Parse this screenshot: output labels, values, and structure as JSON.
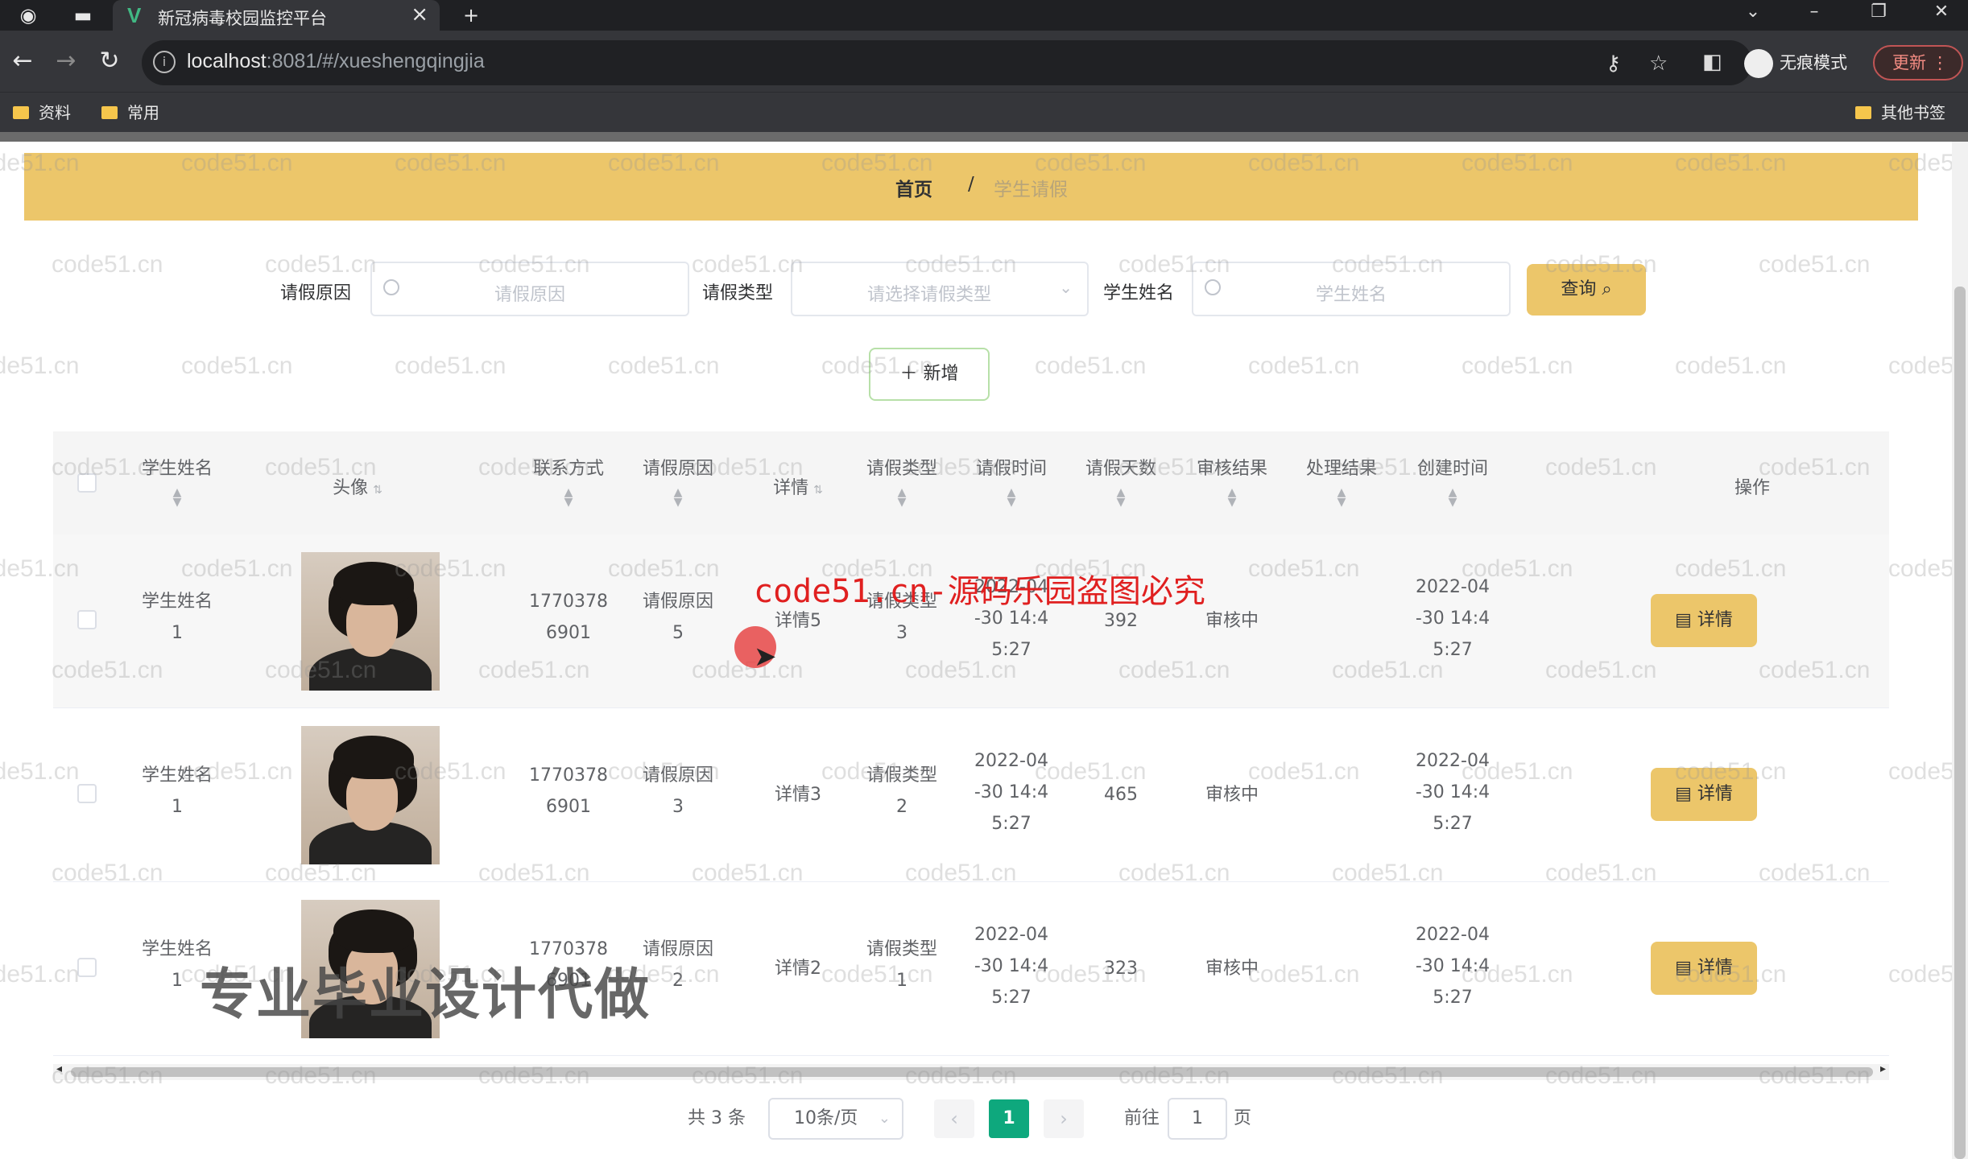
{
  "browser": {
    "tab_title": "新冠病毒校园监控平台",
    "url_host": "localhost",
    "url_rest": ":8081/#/xueshengqingjia",
    "incognito_label": "无痕模式",
    "update_label": "更新",
    "bookmarks": [
      "资料",
      "常用"
    ],
    "other_bookmarks": "其他书签"
  },
  "breadcrumb": {
    "home": "首页",
    "separator": "/",
    "current": "学生请假"
  },
  "search": {
    "fields": [
      {
        "label": "请假原因",
        "placeholder": "请假原因"
      },
      {
        "label": "请假类型",
        "placeholder": "请选择请假类型"
      },
      {
        "label": "学生姓名",
        "placeholder": "学生姓名"
      }
    ],
    "query_label": "查询",
    "add_label": "＋ 新增"
  },
  "table": {
    "columns": [
      "学生姓名",
      "头像",
      "联系方式",
      "请假原因",
      "详情",
      "请假类型",
      "请假时间",
      "请假天数",
      "审核结果",
      "处理结果",
      "创建时间",
      "操作"
    ],
    "rows": [
      {
        "name": "学生姓名\n1",
        "phone": "1770378\n6901",
        "reason": "请假原因\n5",
        "detail": "详情5",
        "type": "请假类型\n3",
        "time": "2022-04\n-30 14:4\n5:27",
        "days": "392",
        "audit": "审核中",
        "result": "",
        "created": "2022-04\n-30 14:4\n5:27"
      },
      {
        "name": "学生姓名\n1",
        "phone": "1770378\n6901",
        "reason": "请假原因\n3",
        "detail": "详情3",
        "type": "请假类型\n2",
        "time": "2022-04\n-30 14:4\n5:27",
        "days": "465",
        "audit": "审核中",
        "result": "",
        "created": "2022-04\n-30 14:4\n5:27"
      },
      {
        "name": "学生姓名\n1",
        "phone": "1770378\n6901",
        "reason": "请假原因\n2",
        "detail": "详情2",
        "type": "请假类型\n1",
        "time": "2022-04\n-30 14:4\n5:27",
        "days": "323",
        "audit": "审核中",
        "result": "",
        "created": "2022-04\n-30 14:4\n5:27"
      }
    ],
    "detail_btn": "详情"
  },
  "pagination": {
    "total": "共 3 条",
    "page_size": "10条/页",
    "current_page": "1",
    "goto_prefix": "前往",
    "goto_value": "1",
    "goto_suffix": "页"
  },
  "overlays": {
    "watermark": "code51.cn",
    "red_banner": "code51.cn-源码乐园盗图必究",
    "gray_banner": "专业毕业设计代做"
  },
  "colors": {
    "accent": "#ecc66a",
    "primary": "#0ea87d"
  }
}
